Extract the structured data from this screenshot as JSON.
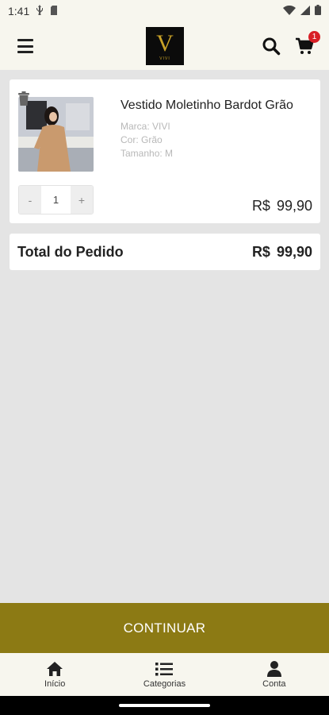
{
  "status_bar": {
    "time": "1:41"
  },
  "header": {
    "logo_letter": "V",
    "logo_sub": "VIVI",
    "cart_count": "1",
    "accent_color": "#c9a227",
    "badge_color": "#d81f26"
  },
  "cart": {
    "items": [
      {
        "name": "Vestido Moletinho Bardot Grão",
        "brand": "Marca: VIVI",
        "color": "Cor: Grão",
        "size": "Tamanho: M",
        "quantity": "1",
        "decrement_label": "-",
        "increment_label": "+",
        "price": "R$ 99,90"
      }
    ],
    "total_label": "Total do Pedido",
    "total_value": "R$ 99,90"
  },
  "continue_label": "CONTINUAR",
  "continue_color": "#8c7a14",
  "bottom_nav": [
    {
      "label": "Início",
      "icon": "home-icon"
    },
    {
      "label": "Categorias",
      "icon": "list-icon"
    },
    {
      "label": "Conta",
      "icon": "user-icon"
    }
  ]
}
